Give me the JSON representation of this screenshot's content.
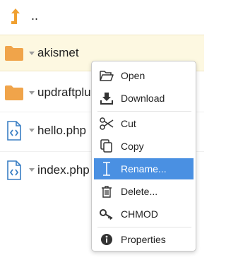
{
  "file_list": {
    "parent_dir": {
      "label": "..",
      "icon": "arrow-up-icon"
    },
    "items": [
      {
        "name": "akismet",
        "type": "folder",
        "icon": "folder-icon",
        "selected": true
      },
      {
        "name": "updraftplus",
        "type": "folder",
        "icon": "folder-icon",
        "selected": false
      },
      {
        "name": "hello.php",
        "type": "php-file",
        "icon": "code-file-icon",
        "selected": false
      },
      {
        "name": "index.php",
        "type": "php-file",
        "icon": "code-file-icon",
        "selected": false
      }
    ]
  },
  "context_menu": {
    "items": [
      {
        "label": "Open",
        "icon": "folder-open-icon"
      },
      {
        "label": "Download",
        "icon": "download-icon"
      },
      {
        "label": "Cut",
        "icon": "scissors-icon"
      },
      {
        "label": "Copy",
        "icon": "copy-icon"
      },
      {
        "label": "Rename...",
        "icon": "text-cursor-icon",
        "active": true
      },
      {
        "label": "Delete...",
        "icon": "trash-icon"
      },
      {
        "label": "CHMOD",
        "icon": "key-icon"
      },
      {
        "label": "Properties",
        "icon": "info-icon"
      }
    ]
  },
  "colors": {
    "folder": "#f0a44a",
    "up_arrow": "#f0a030",
    "php_icon": "#3a7fc4",
    "selected_row": "#fdf8e1",
    "menu_highlight": "#4a90e2"
  }
}
